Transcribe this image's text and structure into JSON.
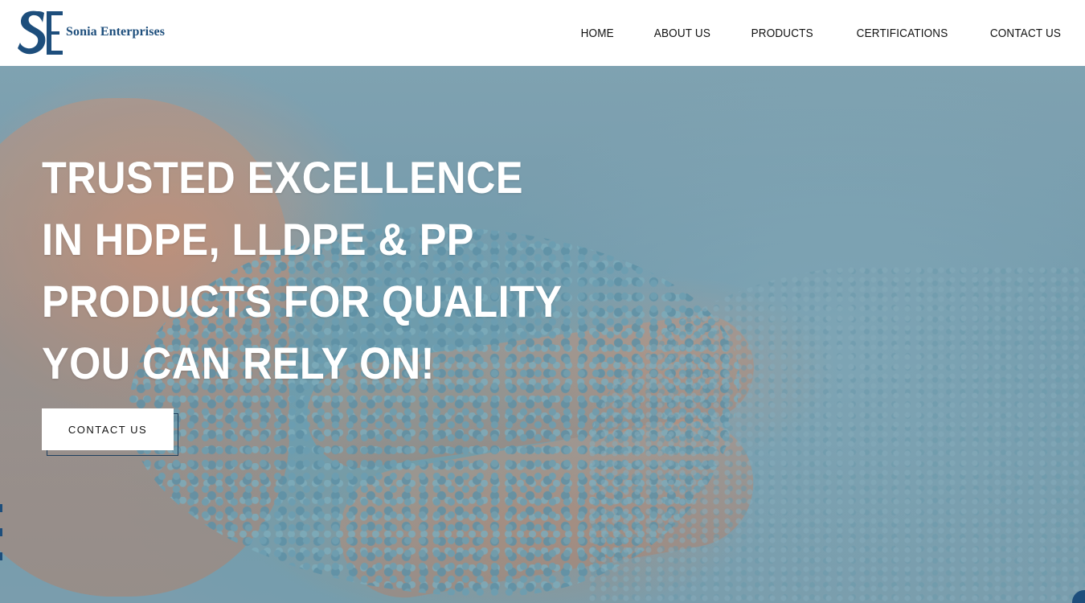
{
  "brand": {
    "name": "Sonia Enterprises",
    "primary_color": "#1d4e7c"
  },
  "nav": {
    "items": [
      {
        "label": "HOME"
      },
      {
        "label": "ABOUT US"
      },
      {
        "label": "PRODUCTS"
      },
      {
        "label": "CERTIFICATIONS"
      },
      {
        "label": "CONTACT US"
      }
    ]
  },
  "hero": {
    "title_lines": [
      "TRUSTED EXCELLENCE",
      "IN HDPE, LLDPE & PP",
      "PRODUCTS FOR QUALITY",
      "YOU CAN RELY ON!"
    ],
    "cta_label": "CONTACT US",
    "background_image": "hand-holding-blue-plastic-pellets"
  }
}
